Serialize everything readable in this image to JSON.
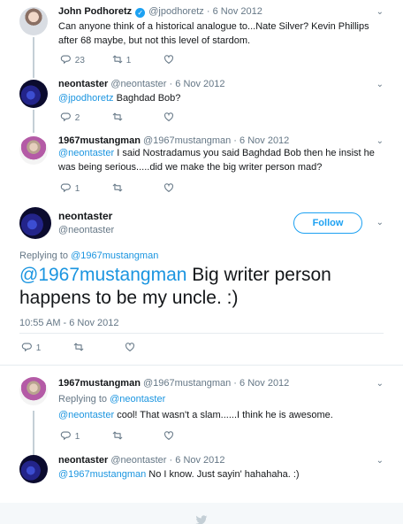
{
  "tweets": [
    {
      "name": "John Podhoretz",
      "handle": "@jpodhoretz",
      "date": "6 Nov 2012",
      "text": "Can anyone think of a historical analogue to...Nate Silver? Kevin Phillips after 68 maybe, but not this level of stardom.",
      "replies": "23",
      "retweets": "1"
    },
    {
      "name": "neontaster",
      "handle": "@neontaster",
      "date": "6 Nov 2012",
      "mention": "@jpodhoretz",
      "text": " Baghdad Bob?",
      "replies": "2"
    },
    {
      "name": "1967mustangman",
      "handle": "@1967mustangman",
      "date": "6 Nov 2012",
      "mention": "@neontaster",
      "text": " I said Nostradamus you said Baghdad Bob then he insist he was being serious.....did we make the big writer person mad?",
      "replies": "1"
    }
  ],
  "focus": {
    "name": "neontaster",
    "handle": "@neontaster",
    "follow_label": "Follow",
    "replying_prefix": "Replying to ",
    "replying_to": "@1967mustangman",
    "mention": "@1967mustangman",
    "text": " Big writer person happens to be my uncle. :)",
    "timestamp": "10:55 AM - 6 Nov 2012",
    "replies": "1"
  },
  "replies": [
    {
      "name": "1967mustangman",
      "handle": "@1967mustangman",
      "date": "6 Nov 2012",
      "replying_prefix": "Replying to ",
      "replying_to": "@neontaster",
      "mention": "@neontaster",
      "text": " cool!  That wasn't a slam......I think he is awesome.",
      "replies": "1"
    },
    {
      "name": "neontaster",
      "handle": "@neontaster",
      "date": "6 Nov 2012",
      "mention": "@1967mustangman",
      "text": " No I know. Just sayin' hahahaha. :)"
    }
  ],
  "separator": "·",
  "icons": [
    "reply-icon",
    "retweet-icon",
    "like-icon",
    "chevron-down-icon",
    "verified-icon"
  ],
  "colors": {
    "accent": "#1da1f2",
    "link": "#1b95e0",
    "muted": "#657786",
    "thread": "#c4cfd6"
  }
}
